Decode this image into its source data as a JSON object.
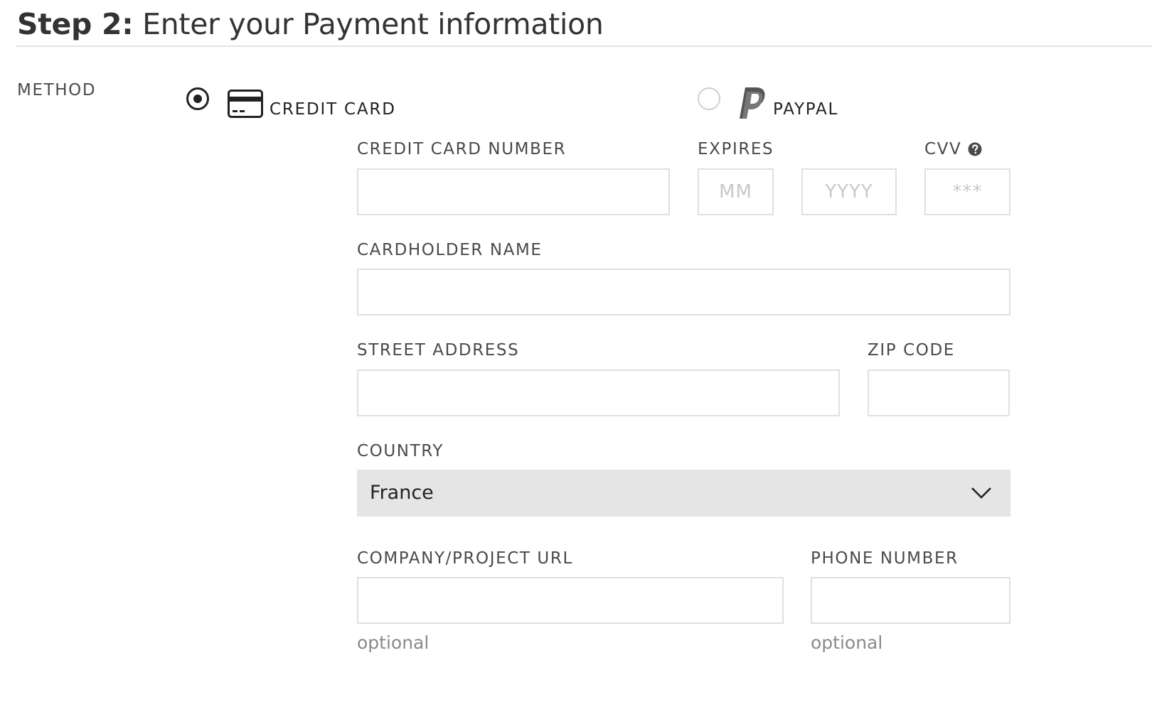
{
  "header": {
    "step_bold": "Step 2:",
    "step_text": " Enter your Payment information"
  },
  "method": {
    "label": "METHOD",
    "options": [
      {
        "label": "CREDIT CARD",
        "selected": true,
        "icon": "credit-card-icon"
      },
      {
        "label": "PAYPAL",
        "selected": false,
        "icon": "paypal-icon"
      }
    ]
  },
  "form": {
    "card_number": {
      "label": "CREDIT CARD NUMBER",
      "value": "",
      "placeholder": ""
    },
    "expires": {
      "label": "EXPIRES",
      "month": {
        "value": "",
        "placeholder": "MM"
      },
      "year": {
        "value": "",
        "placeholder": "YYYY"
      }
    },
    "cvv": {
      "label": "CVV",
      "value": "",
      "placeholder": "***",
      "help_icon": "question-circle-icon"
    },
    "cardholder_name": {
      "label": "CARDHOLDER NAME",
      "value": "",
      "placeholder": ""
    },
    "street_address": {
      "label": "STREET ADDRESS",
      "value": "",
      "placeholder": ""
    },
    "zip_code": {
      "label": "ZIP CODE",
      "value": "",
      "placeholder": ""
    },
    "country": {
      "label": "COUNTRY",
      "selected": "France",
      "icon": "chevron-down-icon"
    },
    "company_url": {
      "label": "COMPANY/PROJECT URL",
      "value": "",
      "placeholder": "",
      "hint": "optional"
    },
    "phone_number": {
      "label": "PHONE NUMBER",
      "value": "",
      "placeholder": "",
      "hint": "optional"
    }
  },
  "colors": {
    "text": "#333333",
    "label": "#4a4a4a",
    "border": "#e0e0e0",
    "select_bg": "#e5e5e5",
    "hint": "#8a8a8a",
    "placeholder": "#c8c8c8"
  }
}
